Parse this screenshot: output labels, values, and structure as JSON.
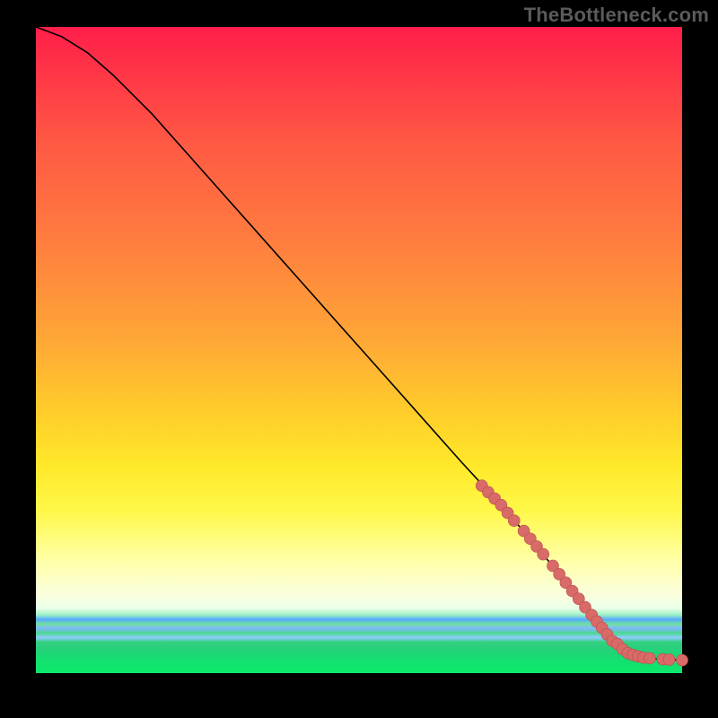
{
  "watermark": "TheBottleneck.com",
  "chart_data": {
    "type": "line",
    "title": "",
    "xlabel": "",
    "ylabel": "",
    "xlim": [
      0,
      100
    ],
    "ylim": [
      0,
      100
    ],
    "grid": false,
    "legend": false,
    "series": [
      {
        "name": "bottleneck-curve",
        "x": [
          0,
          4,
          8,
          12,
          18,
          26,
          34,
          42,
          50,
          58,
          66,
          72,
          78,
          82,
          86,
          88,
          90,
          92,
          94,
          96,
          98,
          100
        ],
        "y": [
          100,
          98.5,
          96,
          92.5,
          86.5,
          77.5,
          68.5,
          59.5,
          50.5,
          41.5,
          32.5,
          26,
          19,
          14,
          9,
          6.5,
          4.5,
          3,
          2.4,
          2.2,
          2.1,
          2.0
        ]
      }
    ],
    "points": [
      {
        "x": 69,
        "y": 29.0
      },
      {
        "x": 70,
        "y": 28.0
      },
      {
        "x": 71,
        "y": 27.0
      },
      {
        "x": 72,
        "y": 26.0
      },
      {
        "x": 73,
        "y": 24.8
      },
      {
        "x": 74,
        "y": 23.6
      },
      {
        "x": 75.5,
        "y": 22.0
      },
      {
        "x": 76.5,
        "y": 20.8
      },
      {
        "x": 77.5,
        "y": 19.6
      },
      {
        "x": 78.5,
        "y": 18.4
      },
      {
        "x": 80,
        "y": 16.6
      },
      {
        "x": 81,
        "y": 15.3
      },
      {
        "x": 82,
        "y": 14.0
      },
      {
        "x": 83,
        "y": 12.7
      },
      {
        "x": 84,
        "y": 11.5
      },
      {
        "x": 85,
        "y": 10.2
      },
      {
        "x": 86,
        "y": 9.0
      },
      {
        "x": 86.8,
        "y": 8.0
      },
      {
        "x": 87.6,
        "y": 7.0
      },
      {
        "x": 88.4,
        "y": 6.0
      },
      {
        "x": 89.2,
        "y": 5.0
      },
      {
        "x": 90,
        "y": 4.5
      },
      {
        "x": 90.8,
        "y": 3.7
      },
      {
        "x": 91.6,
        "y": 3.1
      },
      {
        "x": 92.4,
        "y": 2.8
      },
      {
        "x": 93.2,
        "y": 2.6
      },
      {
        "x": 94,
        "y": 2.4
      },
      {
        "x": 95,
        "y": 2.3
      },
      {
        "x": 97,
        "y": 2.15
      },
      {
        "x": 98,
        "y": 2.1
      },
      {
        "x": 100,
        "y": 2.0
      }
    ],
    "point_color": "#d86a68"
  }
}
